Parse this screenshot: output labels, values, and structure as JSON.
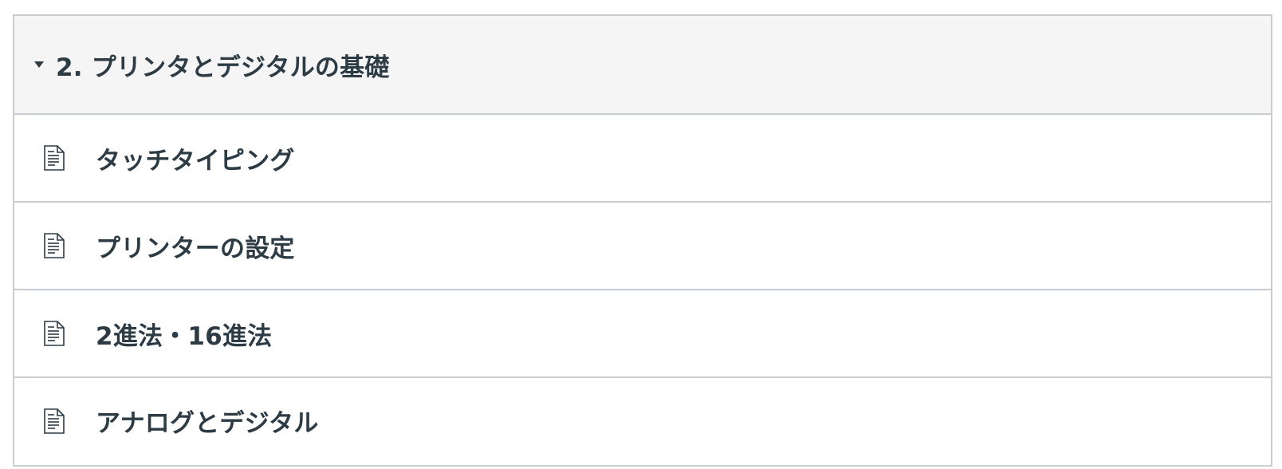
{
  "module": {
    "title": "2. プリンタとデジタルの基礎",
    "expanded": true,
    "toggle_icon": "caret-down-icon",
    "header_background": "#f5f5f5",
    "border_color": "#c7cdd1",
    "text_color": "#2d3b45"
  },
  "items": [
    {
      "label": "タッチタイピング",
      "icon": "document-icon"
    },
    {
      "label": "プリンターの設定",
      "icon": "document-icon"
    },
    {
      "label": "2進法・16進法",
      "icon": "document-icon"
    },
    {
      "label": "アナログとデジタル",
      "icon": "document-icon"
    }
  ]
}
